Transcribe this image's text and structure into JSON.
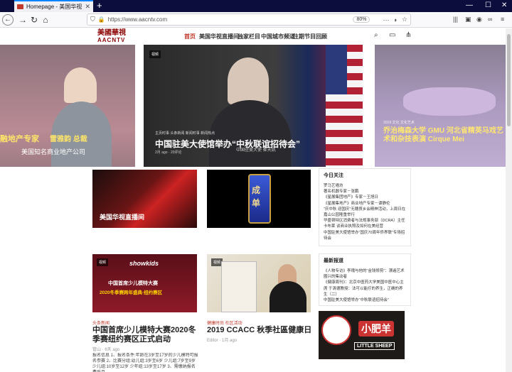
{
  "browser": {
    "tab_title": "Homepage - 美国华视",
    "url": "https://www.aacntv.com",
    "zoom": "80%"
  },
  "site": {
    "logo_cn": "美國華視",
    "logo_en": "AACNTV",
    "nav": [
      "首页",
      "美国华视直播间",
      "独家栏目",
      "中国城市频道",
      "往期节目回顾"
    ]
  },
  "hero": {
    "left": {
      "title_line1": "融地产专家",
      "title_line2": "美国知名商业地产公司",
      "overlay": "雷雅韵 总裁"
    },
    "center": {
      "tag": "视频",
      "categories": "主页时事  头条新闻  新闻时事  新闻热点",
      "title": "中国驻美大使馆举办“中秋联谊招待会”",
      "meta": "2月 ago  ·  20评论",
      "caption": "中国驻美大使 崔天凯"
    },
    "right": {
      "categories": "2019 文化  文化艺术",
      "title": "乔治梅森大学 GMU 河北省精英马戏艺术和杂技表演 Cirque Mei"
    }
  },
  "cards": {
    "live": {
      "label": "美国华视直播间"
    },
    "chendan": {
      "label": "成单"
    },
    "kids": {
      "tag": "视频",
      "img_brand": "showkids",
      "img_line1": "中国首席少儿模特大赛",
      "img_line2": "2020冬季赛跨年盛典·纽约赛区",
      "category": "头条新闻",
      "title": "中国首席少儿模特大赛2020冬季赛纽约赛区正式启动",
      "meta": "管山 · 6天 ago",
      "excerpt": "报名信息 1、报名条件:年龄在3岁至17岁的少儿模特可报名参赛 2、比赛分组:幼儿组:3岁至6岁 少儿组:7岁至9岁 少儿组:10岁至12岁 少年组:13岁至17岁 3、需缴纳报名费后且"
    },
    "cacc": {
      "tag": "视频",
      "category": "健康时尚  社区活动",
      "title": "2019 CCACC 秋季社區健康日",
      "meta": "Editor · 1月 ago"
    }
  },
  "sidebar": {
    "today_title": "今日关注",
    "today_items": [
      "罗马艺墙坊",
      "著名机器专家－张鹏",
      "《星展集团地产》专家－王旭日",
      "《星展集地产》商业地产专家－谭静伦",
      "“庆中秋 迎国庆”无穗贸乡会精神活动，上周日在嘉山公园隆重举行",
      "华盛顿特区消费者与法规事务部（DCRA）主任 卡布莱 谈商业执照及如何在美经营",
      "中国驻美大使馆举办“国庆70周年侨界联”专场招待会"
    ],
    "latest_title": "最新报道",
    "latest_items": [
      "《人物专访》李瑰与他的“金钱修剪”：漂遍艺术圈兴的集动者",
      "《健康周刊》：北京中医药大学美国中医中心主席 于清德教授：法可以能疗的养生，正确的养生（二）",
      "中国驻美大使馆举办“中秋联谊招待会”"
    ],
    "ad_text": "小肥羊",
    "ad_en": "LITTLE SHEEP"
  }
}
